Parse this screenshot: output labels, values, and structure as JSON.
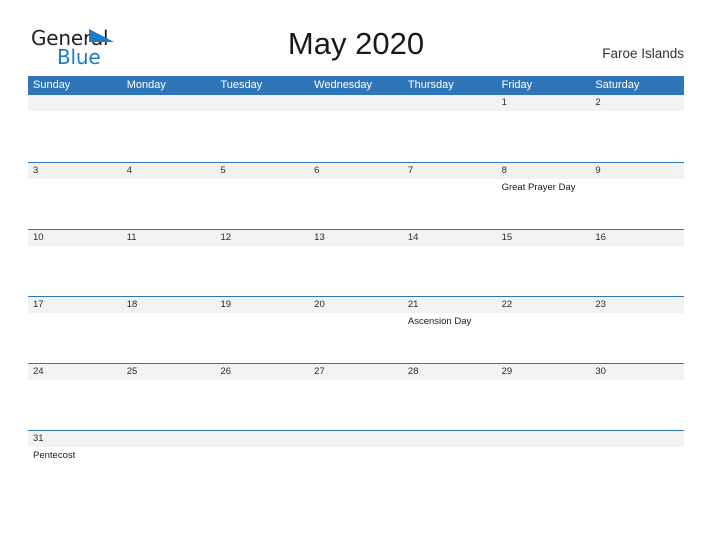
{
  "brand": {
    "name_part1": "General",
    "name_part2": "Blue",
    "flag_icon": "blue-flag-triangle",
    "color_dark": "#231f20",
    "color_blue": "#1f7cc4"
  },
  "header": {
    "title": "May 2020",
    "region": "Faroe Islands"
  },
  "theme": {
    "header_blue": "#2f76b8",
    "date_band_gray": "#f2f2f2",
    "row_rule_blue": "#2f76b8"
  },
  "calendar": {
    "weekdays": [
      "Sunday",
      "Monday",
      "Tuesday",
      "Wednesday",
      "Thursday",
      "Friday",
      "Saturday"
    ],
    "weeks": [
      [
        {
          "date": "",
          "event": ""
        },
        {
          "date": "",
          "event": ""
        },
        {
          "date": "",
          "event": ""
        },
        {
          "date": "",
          "event": ""
        },
        {
          "date": "",
          "event": ""
        },
        {
          "date": "1",
          "event": ""
        },
        {
          "date": "2",
          "event": ""
        }
      ],
      [
        {
          "date": "3",
          "event": ""
        },
        {
          "date": "4",
          "event": ""
        },
        {
          "date": "5",
          "event": ""
        },
        {
          "date": "6",
          "event": ""
        },
        {
          "date": "7",
          "event": ""
        },
        {
          "date": "8",
          "event": "Great Prayer Day"
        },
        {
          "date": "9",
          "event": ""
        }
      ],
      [
        {
          "date": "10",
          "event": ""
        },
        {
          "date": "11",
          "event": ""
        },
        {
          "date": "12",
          "event": ""
        },
        {
          "date": "13",
          "event": ""
        },
        {
          "date": "14",
          "event": ""
        },
        {
          "date": "15",
          "event": ""
        },
        {
          "date": "16",
          "event": ""
        }
      ],
      [
        {
          "date": "17",
          "event": ""
        },
        {
          "date": "18",
          "event": ""
        },
        {
          "date": "19",
          "event": ""
        },
        {
          "date": "20",
          "event": ""
        },
        {
          "date": "21",
          "event": "Ascension Day"
        },
        {
          "date": "22",
          "event": ""
        },
        {
          "date": "23",
          "event": ""
        }
      ],
      [
        {
          "date": "24",
          "event": ""
        },
        {
          "date": "25",
          "event": ""
        },
        {
          "date": "26",
          "event": ""
        },
        {
          "date": "27",
          "event": ""
        },
        {
          "date": "28",
          "event": ""
        },
        {
          "date": "29",
          "event": ""
        },
        {
          "date": "30",
          "event": ""
        }
      ],
      [
        {
          "date": "31",
          "event": "Pentecost"
        },
        {
          "date": "",
          "event": ""
        },
        {
          "date": "",
          "event": ""
        },
        {
          "date": "",
          "event": ""
        },
        {
          "date": "",
          "event": ""
        },
        {
          "date": "",
          "event": ""
        },
        {
          "date": "",
          "event": ""
        }
      ]
    ]
  }
}
